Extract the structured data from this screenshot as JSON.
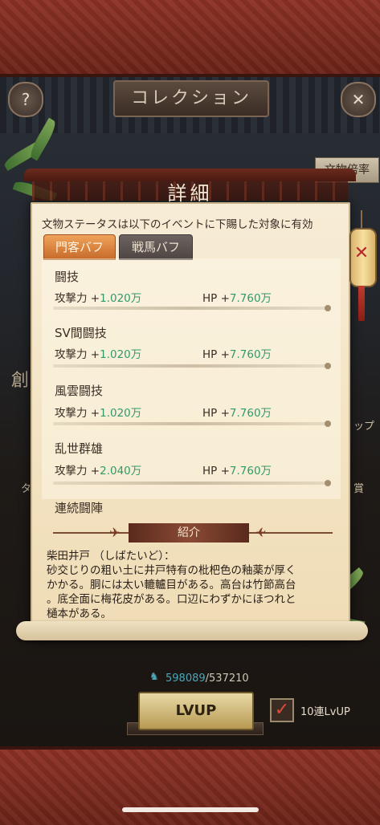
{
  "header": {
    "title": "コレクション",
    "help_icon": "?",
    "close_icon": "✕"
  },
  "side_button": "文物倍率",
  "panel": {
    "title": "詳細",
    "notice": "文物ステータスは以下のイベントに下賜した対象に有効",
    "tabs": [
      {
        "label": "門客バフ",
        "active": true
      },
      {
        "label": "戦馬バフ",
        "active": false
      }
    ],
    "sections": [
      {
        "name": "闘技",
        "attack_label": "攻撃力 +",
        "attack_value": "1.020万",
        "hp_label": "HP +",
        "hp_value": "7.760万"
      },
      {
        "name": "SV間闘技",
        "attack_label": "攻撃力 +",
        "attack_value": "1.020万",
        "hp_label": "HP +",
        "hp_value": "7.760万"
      },
      {
        "name": "風雲闘技",
        "attack_label": "攻撃力 +",
        "attack_value": "1.020万",
        "hp_label": "HP +",
        "hp_value": "7.760万"
      },
      {
        "name": "乱世群雄",
        "attack_label": "攻撃力 +",
        "attack_value": "2.040万",
        "hp_label": "HP +",
        "hp_value": "7.760万"
      },
      {
        "name": "連続闘陣"
      }
    ],
    "intro_title": "紹介",
    "description_lines": [
      "柴田井戸 （しばたいど）：",
      "砂交じりの粗い土に井戸特有の枇杷色の釉薬が厚く",
      "かかる。胴には太い轆轤目がある。高台は竹節高台",
      "。底全面に梅花皮がある。口辺にわずかにほつれと",
      "樋本がある。"
    ]
  },
  "side_remnants": {
    "left_char": "創",
    "right_text": "ップ",
    "right_text2": "賞",
    "left_text2": "タ"
  },
  "footer": {
    "exp_current": "598089",
    "exp_required": "/537210",
    "lvup_label": "LVUP",
    "batch_label": "10連LvUP",
    "batch_checked": "✓"
  },
  "colors": {
    "accent_tab": "#e08a44",
    "value_green": "#2f9a6a",
    "band_red": "#7d2b20"
  }
}
